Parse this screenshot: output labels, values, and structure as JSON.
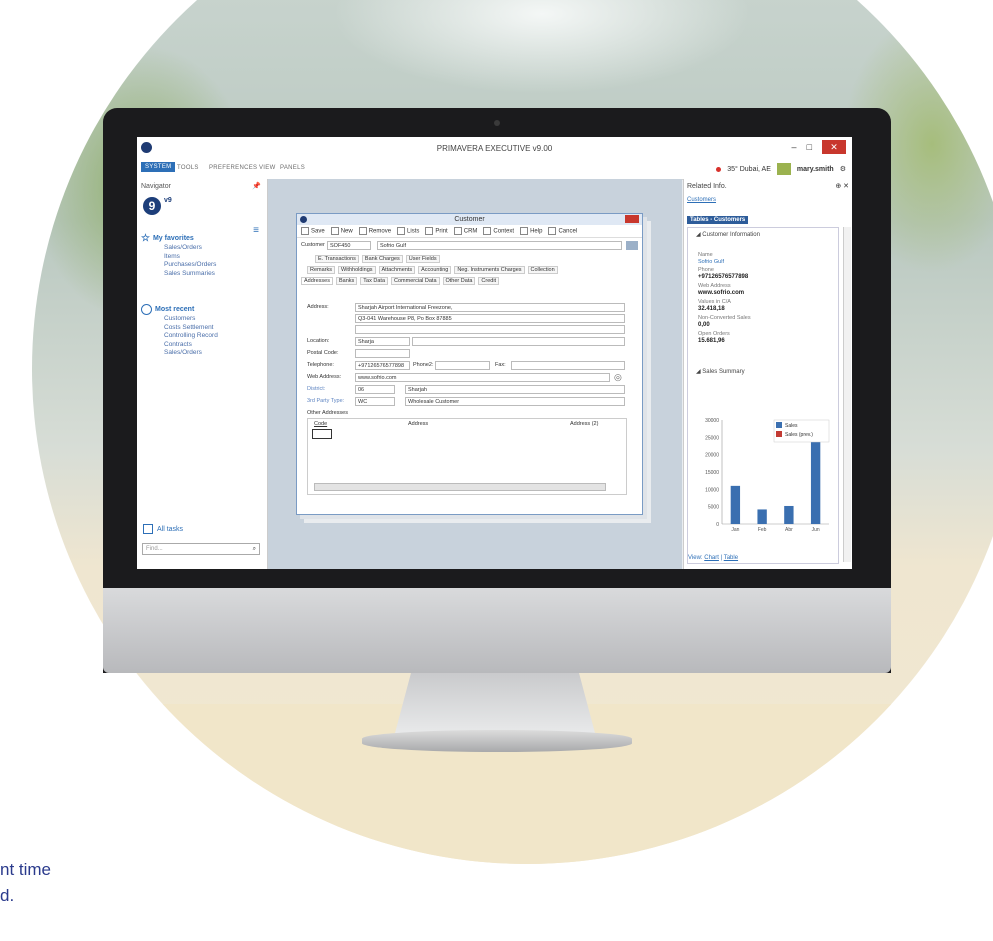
{
  "app": {
    "title": "PRIMAVERA EXECUTIVE v9.00",
    "menu": [
      "SYSTEM",
      "TOOLS",
      "PREFERENCES",
      "VIEW",
      "PANELS"
    ],
    "weather": "35° Dubai, AE",
    "user": "mary.smith"
  },
  "navigator": {
    "title": "Navigator",
    "logo": "9",
    "logo_sup": "v9",
    "favorites_title": "My favorites",
    "favorites": [
      "Sales/Orders",
      "Items",
      "Purchases/Orders",
      "Sales Summaries"
    ],
    "recent_title": "Most recent",
    "recent": [
      "Customers",
      "Costs Settlement",
      "Controlling Record",
      "Contracts",
      "Sales/Orders"
    ],
    "all_tasks": "All tasks",
    "search_placeholder": "Find..."
  },
  "customer": {
    "title": "Customer",
    "toolbar": [
      "Save",
      "New",
      "Remove",
      "Lists",
      "Print",
      "CRM",
      "Context",
      "Help",
      "Cancel"
    ],
    "customer_label": "Customer",
    "customer_code": "SOF450",
    "customer_name": "Sofrio Gulf",
    "tabs_row1": [
      "E. Transactions",
      "Bank Charges",
      "User Fields"
    ],
    "tabs_row2": [
      "Remarks",
      "Withholdings",
      "Attachments",
      "Accounting",
      "Neg. Instruments Charges",
      "Collection"
    ],
    "tabs_row3": [
      "Addresses",
      "Banks",
      "Tax Data",
      "Commercial Data",
      "Other Data",
      "Credit"
    ],
    "address_label": "Address:",
    "address_1": "Sharjah Airport International Freezone,",
    "address_2": "Q3-041 Warehouse P8, Po Box 87885",
    "location_label": "Location:",
    "location": "Sharja",
    "postal_label": "Postal Code:",
    "telephone_label": "Telephone:",
    "telephone": "+97126576577898",
    "phone2_label": "Phone2:",
    "fax_label": "Fax:",
    "web_label": "Web Address:",
    "web": "www.sofrio.com",
    "district_label": "District:",
    "district_code": "06",
    "district_name": "Sharjah",
    "third_party_label": "3rd Party Type:",
    "third_party_code": "WC",
    "third_party_name": "Wholesale Customer",
    "other_addresses": "Other Addresses",
    "col_code": "Code",
    "col_address": "Address",
    "col_address2": "Address (2)"
  },
  "related": {
    "title": "Related Info.",
    "link": "Customers",
    "tab": "Tables - Customers",
    "section1": "Customer Information",
    "name_label": "Name",
    "name_value": "Sofrio Gulf",
    "phone_label": "Phone",
    "phone_value": "+97126576577898",
    "web_label": "Web Address",
    "web_value": "www.sofrio.com",
    "values_label": "Values in C/A",
    "values_value": "32.418,18",
    "nonconv_label": "Non-Converted Sales",
    "nonconv_value": "0,00",
    "open_label": "Open Orders",
    "open_value": "15.681,96",
    "section2": "Sales Summary",
    "view_label": "View:",
    "view_chart": "Chart",
    "view_table": "Table"
  },
  "chart_data": {
    "type": "bar",
    "categories": [
      "Jan",
      "Feb",
      "Abr",
      "Jun"
    ],
    "series": [
      {
        "name": "Sales",
        "values": [
          11000,
          4200,
          5200,
          27000
        ],
        "color": "#3a6fb0"
      },
      {
        "name": "Sales (prev.)",
        "values": [
          0,
          0,
          0,
          0
        ],
        "color": "#c23a33"
      }
    ],
    "yticks": [
      0,
      5000,
      10000,
      15000,
      20000,
      25000,
      30000
    ],
    "ylim": [
      0,
      30000
    ],
    "legend": "top-right"
  },
  "footer_text": [
    "nt time",
    "d."
  ]
}
